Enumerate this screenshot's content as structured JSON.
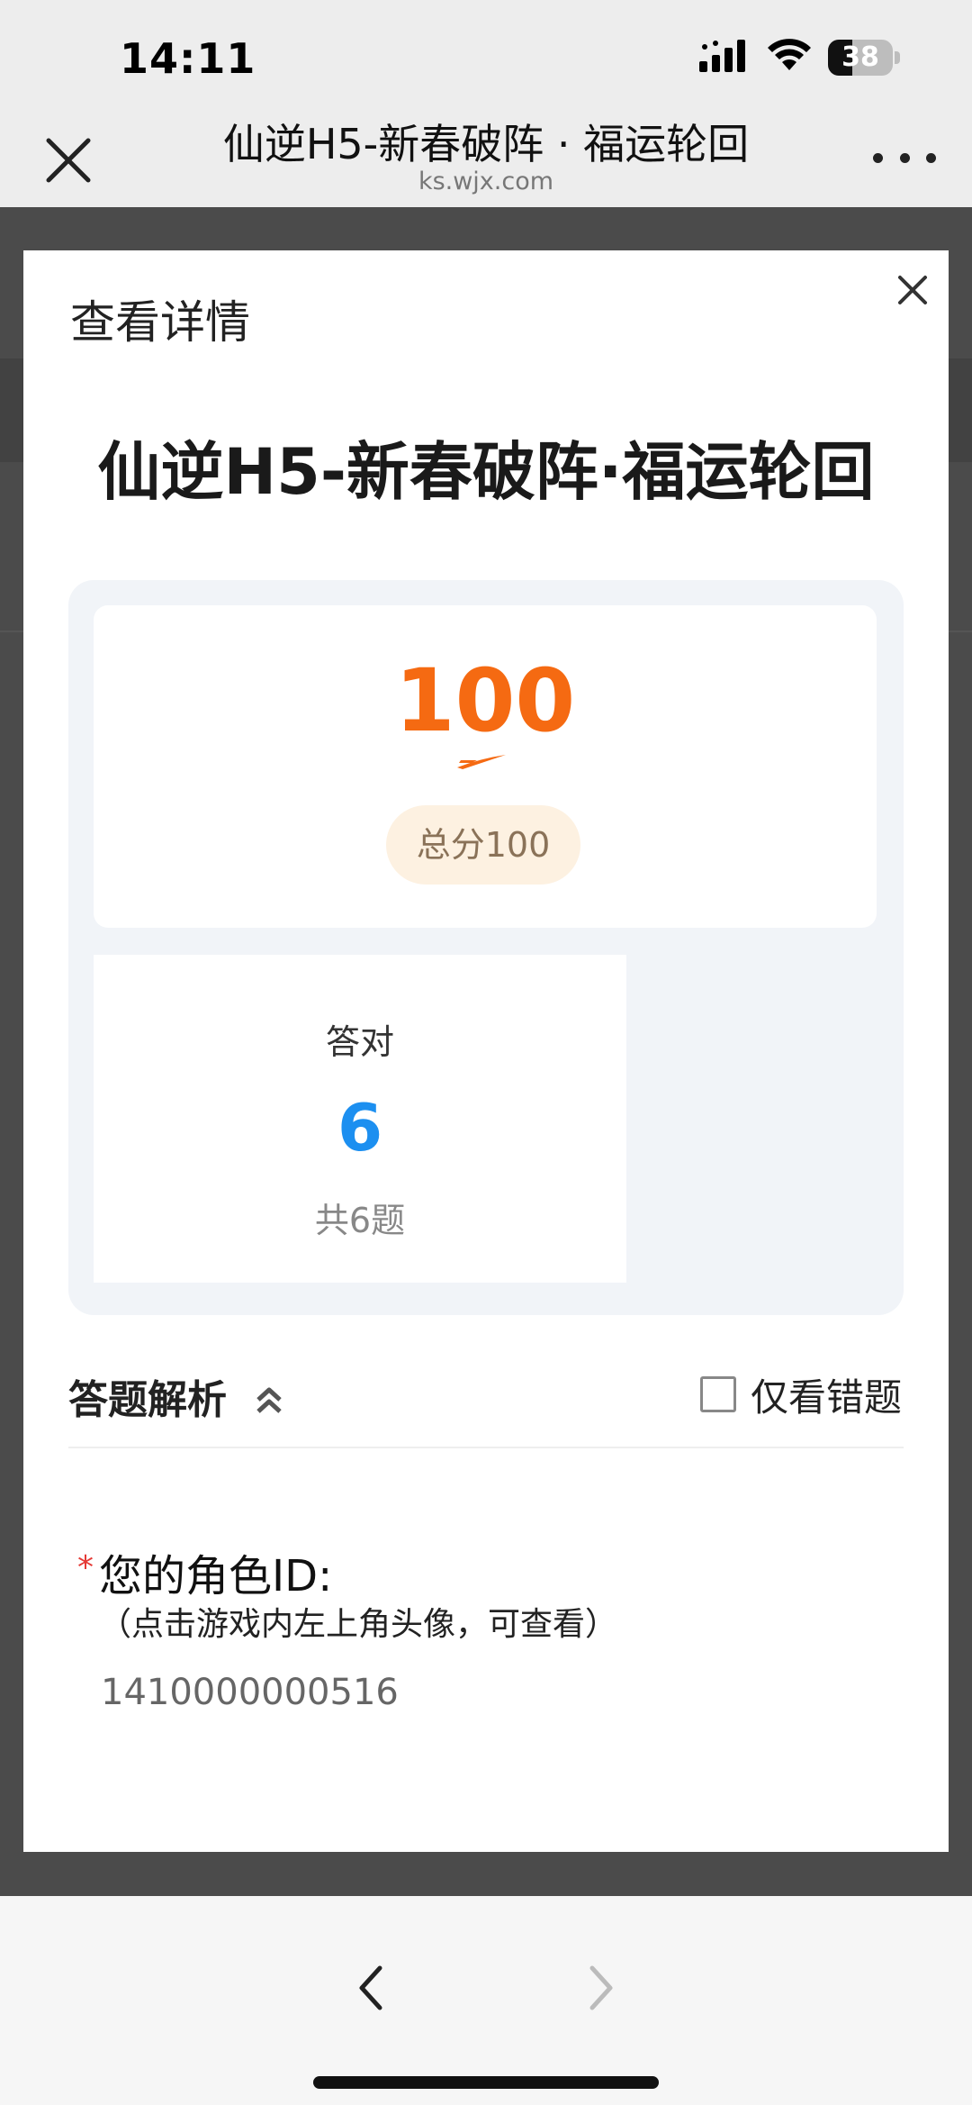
{
  "status_bar": {
    "time": "14:11",
    "battery_level": "38",
    "battery_fraction": 0.38,
    "icons": [
      "cellular-signal-icon",
      "wifi-icon",
      "battery-icon"
    ]
  },
  "nav": {
    "title": "仙逆H5-新春破阵 · 福运轮回",
    "url": "ks.wjx.com",
    "close_icon": "close-icon",
    "more_icon": "more-dots-icon"
  },
  "modal": {
    "heading": "查看详情",
    "survey_title": "仙逆H5-新春破阵·福运轮回",
    "score": {
      "value": "100",
      "total_label": "总分100",
      "accent_color": "#f56a12"
    },
    "correct": {
      "label": "答对",
      "value": "6",
      "total": "共6题",
      "accent_color": "#1c8ff0"
    },
    "analysis": {
      "label": "答题解析",
      "collapse_icon": "double-chevron-up-icon",
      "filter_label": "仅看错题",
      "filter_checked": false
    },
    "question": {
      "required_mark": "*",
      "title": "您的角色ID:",
      "hint": "（点击游戏内左上角头像，可查看）",
      "answer": "1410000000516"
    }
  },
  "toolbar": {
    "back_icon": "chevron-left-icon",
    "forward_icon": "chevron-right-icon"
  }
}
